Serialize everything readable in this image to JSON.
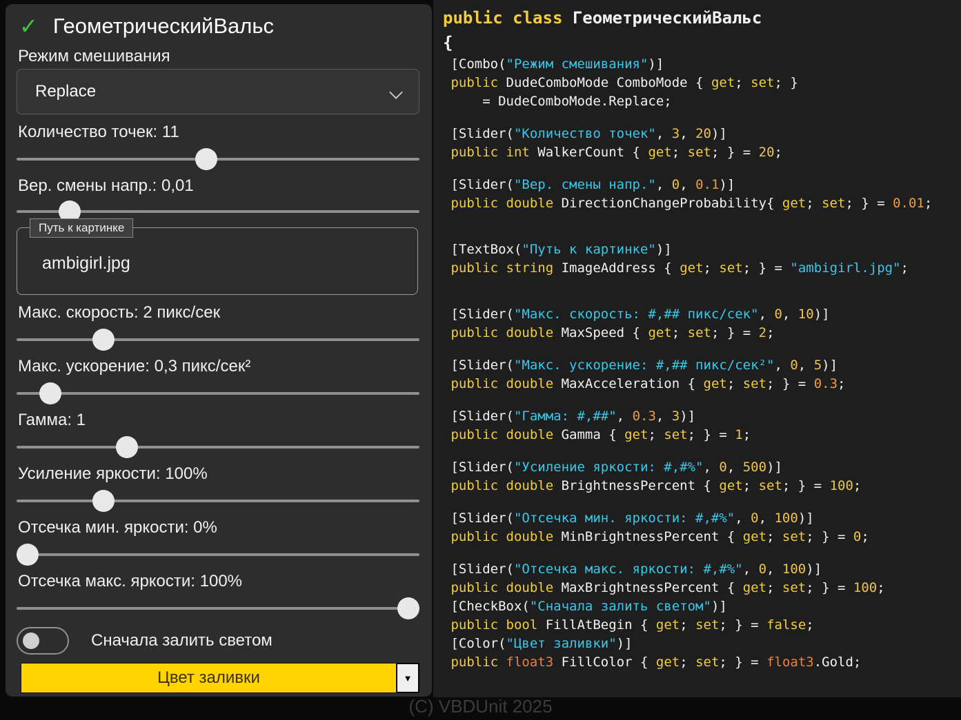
{
  "panel": {
    "title": "ГеометрическийВальс",
    "check_icon": "✓",
    "combo_label": "Режим смешивания",
    "combo_value": "Replace",
    "sliders": [
      {
        "label": "Количество точек: 11",
        "pct": 47
      },
      {
        "label": "Вер. смены напр.: 0,01",
        "pct": 11
      },
      {
        "label": "Макс. скорость: 2 пикс/сек",
        "pct": 20
      },
      {
        "label": "Макс. ускорение: 0,3 пикс/сек²",
        "pct": 6
      },
      {
        "label": "Гамма: 1",
        "pct": 26
      },
      {
        "label": "Усиление яркости: 100%",
        "pct": 20
      },
      {
        "label": "Отсечка мин. яркости: 0%",
        "pct": 0
      },
      {
        "label": "Отсечка макс. яркости: 100%",
        "pct": 100
      }
    ],
    "textbox": {
      "label": "Путь к картинке",
      "value": "ambigirl.jpg"
    },
    "toggle_label": "Сначала залить светом",
    "color_button": {
      "label": "Цвет заливки",
      "color": "#FFD400",
      "arrow": "▼"
    }
  },
  "watermark": "(C) VBDUnit 2025",
  "code": {
    "header_lines": [
      [
        {
          "c": "k",
          "t": "public class "
        },
        {
          "c": "p",
          "t": "ГеометрическийВальс"
        }
      ],
      [
        {
          "c": "p",
          "t": "{"
        }
      ]
    ],
    "lines": [
      [
        {
          "c": "p",
          "t": " [Combo("
        },
        {
          "c": "s",
          "t": "\"Режим смешивания\""
        },
        {
          "c": "p",
          "t": ")]"
        }
      ],
      [
        {
          "c": "k",
          "t": " public"
        },
        {
          "c": "p",
          "t": " DudeComboMode ComboMode { "
        },
        {
          "c": "k",
          "t": "get"
        },
        {
          "c": "p",
          "t": "; "
        },
        {
          "c": "k",
          "t": "set"
        },
        {
          "c": "p",
          "t": "; }"
        }
      ],
      [
        {
          "c": "p",
          "t": "     = DudeComboMode.Replace;"
        }
      ],
      [],
      [
        {
          "c": "p",
          "t": " [Slider("
        },
        {
          "c": "s",
          "t": "\"Количество точек\""
        },
        {
          "c": "p",
          "t": ", "
        },
        {
          "c": "n",
          "t": "3"
        },
        {
          "c": "p",
          "t": ", "
        },
        {
          "c": "n",
          "t": "20"
        },
        {
          "c": "p",
          "t": ")]"
        }
      ],
      [
        {
          "c": "k",
          "t": " public int"
        },
        {
          "c": "p",
          "t": " WalkerCount { "
        },
        {
          "c": "k",
          "t": "get"
        },
        {
          "c": "p",
          "t": "; "
        },
        {
          "c": "k",
          "t": "set"
        },
        {
          "c": "p",
          "t": "; } = "
        },
        {
          "c": "n",
          "t": "20"
        },
        {
          "c": "p",
          "t": ";"
        }
      ],
      [],
      [
        {
          "c": "p",
          "t": " [Slider("
        },
        {
          "c": "s",
          "t": "\"Вер. смены напр.\""
        },
        {
          "c": "p",
          "t": ", "
        },
        {
          "c": "n",
          "t": "0"
        },
        {
          "c": "p",
          "t": ", "
        },
        {
          "c": "f",
          "t": "0.1"
        },
        {
          "c": "p",
          "t": ")]"
        }
      ],
      [
        {
          "c": "k",
          "t": " public double"
        },
        {
          "c": "p",
          "t": " DirectionChangeProbability{ "
        },
        {
          "c": "k",
          "t": "get"
        },
        {
          "c": "p",
          "t": "; "
        },
        {
          "c": "k",
          "t": "set"
        },
        {
          "c": "p",
          "t": "; } = "
        },
        {
          "c": "f",
          "t": "0.01"
        },
        {
          "c": "p",
          "t": ";"
        }
      ],
      [],
      [],
      [
        {
          "c": "p",
          "t": " [TextBox("
        },
        {
          "c": "s",
          "t": "\"Путь к картинке\""
        },
        {
          "c": "p",
          "t": ")]"
        }
      ],
      [
        {
          "c": "k",
          "t": " public string"
        },
        {
          "c": "p",
          "t": " ImageAddress { "
        },
        {
          "c": "k",
          "t": "get"
        },
        {
          "c": "p",
          "t": "; "
        },
        {
          "c": "k",
          "t": "set"
        },
        {
          "c": "p",
          "t": "; } = "
        },
        {
          "c": "s",
          "t": "\"ambigirl.jpg\""
        },
        {
          "c": "p",
          "t": ";"
        }
      ],
      [],
      [],
      [
        {
          "c": "p",
          "t": " [Slider("
        },
        {
          "c": "s",
          "t": "\"Макс. скорость: #,## пикс/сек\""
        },
        {
          "c": "p",
          "t": ", "
        },
        {
          "c": "n",
          "t": "0"
        },
        {
          "c": "p",
          "t": ", "
        },
        {
          "c": "n",
          "t": "10"
        },
        {
          "c": "p",
          "t": ")]"
        }
      ],
      [
        {
          "c": "k",
          "t": " public double"
        },
        {
          "c": "p",
          "t": " MaxSpeed { "
        },
        {
          "c": "k",
          "t": "get"
        },
        {
          "c": "p",
          "t": "; "
        },
        {
          "c": "k",
          "t": "set"
        },
        {
          "c": "p",
          "t": "; } = "
        },
        {
          "c": "n",
          "t": "2"
        },
        {
          "c": "p",
          "t": ";"
        }
      ],
      [],
      [
        {
          "c": "p",
          "t": " [Slider("
        },
        {
          "c": "s",
          "t": "\"Макс. ускорение: #,## пикс/сек²\""
        },
        {
          "c": "p",
          "t": ", "
        },
        {
          "c": "n",
          "t": "0"
        },
        {
          "c": "p",
          "t": ", "
        },
        {
          "c": "n",
          "t": "5"
        },
        {
          "c": "p",
          "t": ")]"
        }
      ],
      [
        {
          "c": "k",
          "t": " public double"
        },
        {
          "c": "p",
          "t": " MaxAcceleration { "
        },
        {
          "c": "k",
          "t": "get"
        },
        {
          "c": "p",
          "t": "; "
        },
        {
          "c": "k",
          "t": "set"
        },
        {
          "c": "p",
          "t": "; } = "
        },
        {
          "c": "f",
          "t": "0.3"
        },
        {
          "c": "p",
          "t": ";"
        }
      ],
      [],
      [
        {
          "c": "p",
          "t": " [Slider("
        },
        {
          "c": "s",
          "t": "\"Гамма: #,##\""
        },
        {
          "c": "p",
          "t": ", "
        },
        {
          "c": "f",
          "t": "0.3"
        },
        {
          "c": "p",
          "t": ", "
        },
        {
          "c": "n",
          "t": "3"
        },
        {
          "c": "p",
          "t": ")]"
        }
      ],
      [
        {
          "c": "k",
          "t": " public double"
        },
        {
          "c": "p",
          "t": " Gamma { "
        },
        {
          "c": "k",
          "t": "get"
        },
        {
          "c": "p",
          "t": "; "
        },
        {
          "c": "k",
          "t": "set"
        },
        {
          "c": "p",
          "t": "; } = "
        },
        {
          "c": "n",
          "t": "1"
        },
        {
          "c": "p",
          "t": ";"
        }
      ],
      [],
      [
        {
          "c": "p",
          "t": " [Slider("
        },
        {
          "c": "s",
          "t": "\"Усиление яркости: #,#%\""
        },
        {
          "c": "p",
          "t": ", "
        },
        {
          "c": "n",
          "t": "0"
        },
        {
          "c": "p",
          "t": ", "
        },
        {
          "c": "n",
          "t": "500"
        },
        {
          "c": "p",
          "t": ")]"
        }
      ],
      [
        {
          "c": "k",
          "t": " public double"
        },
        {
          "c": "p",
          "t": " BrightnessPercent { "
        },
        {
          "c": "k",
          "t": "get"
        },
        {
          "c": "p",
          "t": "; "
        },
        {
          "c": "k",
          "t": "set"
        },
        {
          "c": "p",
          "t": "; } = "
        },
        {
          "c": "n",
          "t": "100"
        },
        {
          "c": "p",
          "t": ";"
        }
      ],
      [],
      [
        {
          "c": "p",
          "t": " [Slider("
        },
        {
          "c": "s",
          "t": "\"Отсечка мин. яркости: #,#%\""
        },
        {
          "c": "p",
          "t": ", "
        },
        {
          "c": "n",
          "t": "0"
        },
        {
          "c": "p",
          "t": ", "
        },
        {
          "c": "n",
          "t": "100"
        },
        {
          "c": "p",
          "t": ")]"
        }
      ],
      [
        {
          "c": "k",
          "t": " public double"
        },
        {
          "c": "p",
          "t": " MinBrightnessPercent { "
        },
        {
          "c": "k",
          "t": "get"
        },
        {
          "c": "p",
          "t": "; "
        },
        {
          "c": "k",
          "t": "set"
        },
        {
          "c": "p",
          "t": "; } = "
        },
        {
          "c": "n",
          "t": "0"
        },
        {
          "c": "p",
          "t": ";"
        }
      ],
      [],
      [
        {
          "c": "p",
          "t": " [Slider("
        },
        {
          "c": "s",
          "t": "\"Отсечка макс. яркости: #,#%\""
        },
        {
          "c": "p",
          "t": ", "
        },
        {
          "c": "n",
          "t": "0"
        },
        {
          "c": "p",
          "t": ", "
        },
        {
          "c": "n",
          "t": "100"
        },
        {
          "c": "p",
          "t": ")]"
        }
      ],
      [
        {
          "c": "k",
          "t": " public double"
        },
        {
          "c": "p",
          "t": " MaxBrightnessPercent { "
        },
        {
          "c": "k",
          "t": "get"
        },
        {
          "c": "p",
          "t": "; "
        },
        {
          "c": "k",
          "t": "set"
        },
        {
          "c": "p",
          "t": "; } = "
        },
        {
          "c": "n",
          "t": "100"
        },
        {
          "c": "p",
          "t": ";"
        }
      ],
      [
        {
          "c": "p",
          "t": " [CheckBox("
        },
        {
          "c": "s",
          "t": "\"Сначала залить светом\""
        },
        {
          "c": "p",
          "t": ")]"
        }
      ],
      [
        {
          "c": "k",
          "t": " public bool"
        },
        {
          "c": "p",
          "t": " FillAtBegin { "
        },
        {
          "c": "k",
          "t": "get"
        },
        {
          "c": "p",
          "t": "; "
        },
        {
          "c": "k",
          "t": "set"
        },
        {
          "c": "p",
          "t": "; } = "
        },
        {
          "c": "k",
          "t": "false"
        },
        {
          "c": "p",
          "t": ";"
        }
      ],
      [
        {
          "c": "p",
          "t": " [Color("
        },
        {
          "c": "s",
          "t": "\"Цвет заливки\""
        },
        {
          "c": "p",
          "t": ")]"
        }
      ],
      [
        {
          "c": "k",
          "t": " public "
        },
        {
          "c": "t",
          "t": "float3"
        },
        {
          "c": "p",
          "t": " FillColor { "
        },
        {
          "c": "k",
          "t": "get"
        },
        {
          "c": "p",
          "t": "; "
        },
        {
          "c": "k",
          "t": "set"
        },
        {
          "c": "p",
          "t": "; } = "
        },
        {
          "c": "t",
          "t": "float3"
        },
        {
          "c": "p",
          "t": ".Gold;"
        }
      ]
    ]
  }
}
